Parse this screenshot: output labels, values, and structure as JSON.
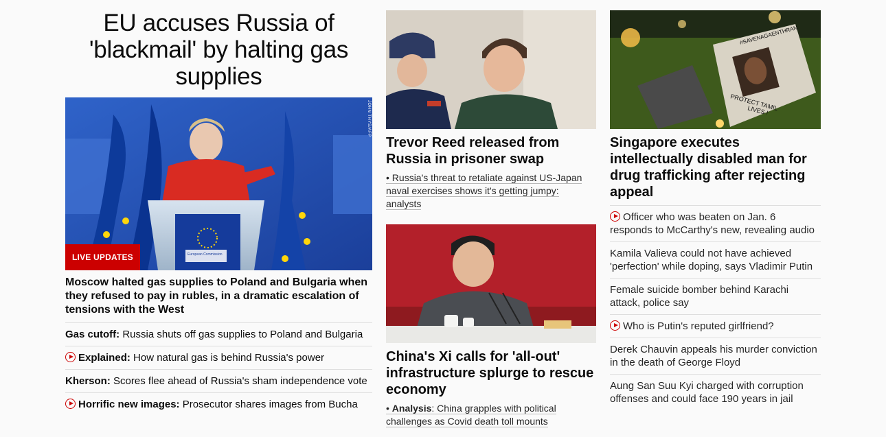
{
  "lead": {
    "title": "EU accuses Russia of 'blackmail' by halting gas supplies",
    "badge": "LIVE UPDATES",
    "photo_credit": "JOHN THYS/AFP",
    "podium_text": "European Commission",
    "summary": "Moscow halted gas supplies to Poland and Bulgaria when they refused to pay in rubles, in a dramatic escalation of tensions with the West",
    "related": [
      {
        "video": false,
        "label": "Gas cutoff:",
        "text": " Russia shuts off gas supplies to Poland and Bulgaria"
      },
      {
        "video": true,
        "label": "Explained:",
        "text": " How natural gas is behind Russia's power"
      },
      {
        "video": false,
        "label": "Kherson:",
        "text": " Scores flee ahead of Russia's sham independence vote"
      },
      {
        "video": true,
        "label": "Horrific new images:",
        "text": " Prosecutor shares images from Bucha"
      }
    ]
  },
  "middle": {
    "story1": {
      "title": "Trevor Reed released from Russia in prisoner swap",
      "sub_prefix": "• ",
      "sub_text": "Russia's threat to retaliate against US-Japan naval exercises shows it's getting jumpy: analysts"
    },
    "story2": {
      "title": "China's Xi calls for 'all-out' infrastructure splurge to rescue economy",
      "sub_prefix": "• ",
      "sub_label": "Analysis",
      "sub_text": ": China grapples with political challenges as Covid death toll mounts"
    }
  },
  "right": {
    "sign_text": "#SAVENAGAENTHRAN",
    "sign_caption_1": "PROTECT TAMIL",
    "sign_caption_2": "LIVES !",
    "title": "Singapore executes intellectually disabled man for drug trafficking after rejecting appeal",
    "items": [
      {
        "video": true,
        "text": "Officer who was beaten on Jan. 6 responds to McCarthy's new, revealing audio"
      },
      {
        "video": false,
        "text": "Kamila Valieva could not have achieved 'perfection' while doping, says Vladimir Putin"
      },
      {
        "video": false,
        "text": "Female suicide bomber behind Karachi attack, police say"
      },
      {
        "video": true,
        "text": "Who is Putin's reputed girlfriend?"
      },
      {
        "video": false,
        "text": "Derek Chauvin appeals his murder conviction in the death of George Floyd"
      },
      {
        "video": false,
        "text": "Aung San Suu Kyi charged with corruption offenses and could face 190 years in jail"
      }
    ]
  },
  "colors": {
    "accent": "#cc0000",
    "text": "#0c0c0c",
    "divider": "#dedede"
  }
}
